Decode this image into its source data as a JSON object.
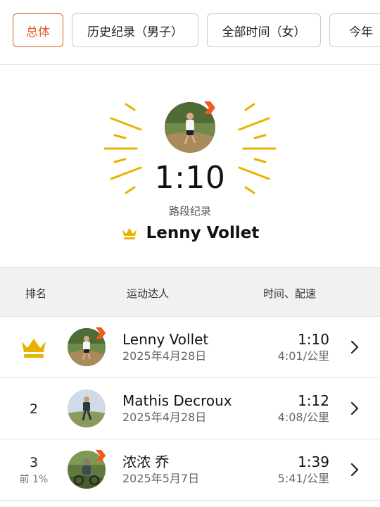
{
  "filters": [
    {
      "label": "总体",
      "active": true
    },
    {
      "label": "历史纪录（男子）",
      "active": false
    },
    {
      "label": "全部时间（女）",
      "active": false
    },
    {
      "label": "今年",
      "active": false
    }
  ],
  "hero": {
    "time": "1:10",
    "label": "路段纪录",
    "holder": "Lenny Vollet"
  },
  "table": {
    "headers": {
      "rank": "排名",
      "athlete": "运动达人",
      "time_pace": "时间、配速"
    },
    "rows": [
      {
        "rank": "",
        "rank_icon": "crown-icon",
        "rank_sub": "",
        "name": "Lenny Vollet",
        "date": "2025年4月28日",
        "time": "1:10",
        "pace": "4:01/公里",
        "badge": true
      },
      {
        "rank": "2",
        "rank_sub": "",
        "name": "Mathis Decroux",
        "date": "2025年4月28日",
        "time": "1:12",
        "pace": "4:08/公里",
        "badge": false
      },
      {
        "rank": "3",
        "rank_sub": "前 1%",
        "name": "浓浓 乔",
        "date": "2025年5月7日",
        "time": "1:39",
        "pace": "5:41/公里",
        "badge": true
      }
    ]
  },
  "colors": {
    "accent": "#e35b22",
    "gold": "#e8b300",
    "header_bg": "#f1f1f1",
    "divider": "#e2e2e2"
  }
}
